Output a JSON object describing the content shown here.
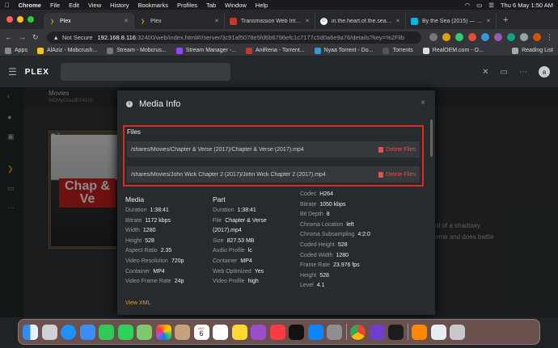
{
  "menubar": {
    "app": "Chrome",
    "items": [
      "File",
      "Edit",
      "View",
      "History",
      "Bookmarks",
      "Profiles",
      "Tab",
      "Window",
      "Help"
    ],
    "datetime": "Thu 6 May  1:50 AM"
  },
  "tabs": [
    {
      "title": "Plex",
      "icon": "plex-chevron-icon",
      "color": "#e5a00d",
      "active": true
    },
    {
      "title": "Plex",
      "icon": "plex-chevron-icon",
      "color": "#e5a00d",
      "active": false
    },
    {
      "title": "Transmission Web Interface",
      "icon": "transmission-icon",
      "color": "#c0392b",
      "active": false
    },
    {
      "title": "in.the.heart.of.the.sea.201",
      "icon": "google-icon",
      "color": "#4285f4",
      "active": false
    },
    {
      "title": "By the Sea (2015) — The M",
      "icon": "tmdb-icon",
      "color": "#01b4e4",
      "active": false
    }
  ],
  "address": {
    "not_secure": "Not Secure",
    "host": "192.168.8.116",
    "path": ":32400/web/index.html#!/server/3c91af5078e5fd6b6796efc1c7177c5d0a6e9a76/details?key=%2Flib"
  },
  "bookmarks": [
    {
      "label": "Apps",
      "color": "#888"
    },
    {
      "label": "AlAziz - Mobcrush...",
      "color": "#f5c518"
    },
    {
      "label": "Stream - Mobcrus...",
      "color": "#777"
    },
    {
      "label": "Stream Manager -...",
      "color": "#9146ff"
    },
    {
      "label": "AniRena - Torrent...",
      "color": "#c0392b"
    },
    {
      "label": "Nyaa Torrent - Do...",
      "color": "#3498db"
    },
    {
      "label": "Torrents",
      "color": "#555"
    },
    {
      "label": "RealOEM.com - O...",
      "color": "#ddd"
    },
    {
      "label": "Reading List",
      "color": "#aaa"
    }
  ],
  "plex": {
    "logo": "PLEX",
    "avatar": "a",
    "section": "Movies",
    "server": "WDMyCloudEX4100",
    "badge": "2",
    "synopsis": [
      "ol of a shadowy",
      "ome and does battle"
    ],
    "poster_title": "Chap & Ve"
  },
  "modal": {
    "title": "Media Info",
    "close": "×",
    "files_title": "Files",
    "files": [
      {
        "path": "/shares/Movies/Chapter & Verse (2017)/Chapter & Verse (2017).mp4",
        "action": "Delete Files"
      },
      {
        "path": "/shares/Movies/John Wick Chapter 2 (2017)/John Wick Chapter 2 (2017).mp4",
        "action": "Delete Files"
      }
    ],
    "media": {
      "heading": "Media",
      "rows": [
        [
          "Duration",
          "1:38:41"
        ],
        [
          "Bitrate",
          "1172 kbps"
        ],
        [
          "Width",
          "1280"
        ],
        [
          "Height",
          "528"
        ],
        [
          "Aspect Ratio",
          "2.35"
        ],
        [
          "Video Resolution",
          "720p"
        ],
        [
          "Container",
          "MP4"
        ],
        [
          "Video Frame Rate",
          "24p"
        ]
      ]
    },
    "part": {
      "heading": "Part",
      "rows": [
        [
          "Duration",
          "1:38:41"
        ],
        [
          "File",
          "Chapter & Verse"
        ],
        [
          "",
          "(2017).mp4"
        ],
        [
          "Size",
          "827.53 MB"
        ],
        [
          "Audio Profile",
          "lc"
        ],
        [
          "Container",
          "MP4"
        ],
        [
          "Web Optimized",
          "Yes"
        ],
        [
          "Video Profile",
          "high"
        ]
      ]
    },
    "codec": {
      "rows": [
        [
          "Codec",
          "H264"
        ],
        [
          "Bitrate",
          "1050 kbps"
        ],
        [
          "Bit Depth",
          "8"
        ],
        [
          "Chroma Location",
          "left"
        ],
        [
          "Chroma Subsampling",
          "4:2:0"
        ],
        [
          "Coded Height",
          "528"
        ],
        [
          "Coded Width",
          "1280"
        ],
        [
          "Frame Rate",
          "23.976 fps"
        ],
        [
          "Height",
          "528"
        ],
        [
          "Level",
          "4.1"
        ]
      ]
    },
    "view_xml": "View XML"
  },
  "dock": {
    "apps": [
      "finder",
      "launchpad",
      "safari",
      "mail",
      "facetime",
      "messages",
      "maps",
      "photos",
      "contacts",
      "calendar",
      "reminders",
      "notes",
      "podcasts",
      "music",
      "tv",
      "app-store",
      "system-preferences",
      "chrome",
      "github",
      "terminal",
      "vlc",
      "preview",
      "trash"
    ],
    "calendar_day": "6",
    "calendar_month": "MAY"
  }
}
